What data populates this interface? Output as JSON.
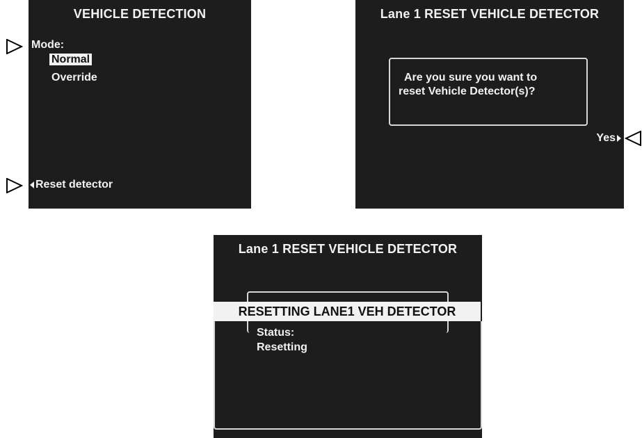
{
  "screen1": {
    "title": "VEHICLE DETECTION",
    "mode_label": "Mode:",
    "options": [
      "Normal",
      "Override"
    ],
    "selected_option": "Normal",
    "reset_label": "Reset detector"
  },
  "screen2": {
    "title": "Lane 1 RESET VEHICLE DETECTOR",
    "dialog_line1": "Are you sure you want to",
    "dialog_line2": "reset Vehicle Detector(s)?",
    "yes_label": "Yes"
  },
  "screen3": {
    "title": "Lane 1 RESET VEHICLE DETECTOR",
    "banner": "RESETTING LANE1 VEH DETECTOR",
    "status_label": "Status:",
    "status_value": "Resetting"
  },
  "pointers": {
    "mode_pointer": "right-triangle-outline-icon",
    "reset_pointer": "right-triangle-outline-icon",
    "yes_pointer": "left-triangle-outline-icon"
  },
  "colors": {
    "screen_bg": "#1d1d1d",
    "screen_text": "#f2f2f2",
    "highlight_bg": "#f2f2f2",
    "highlight_text": "#111111"
  }
}
